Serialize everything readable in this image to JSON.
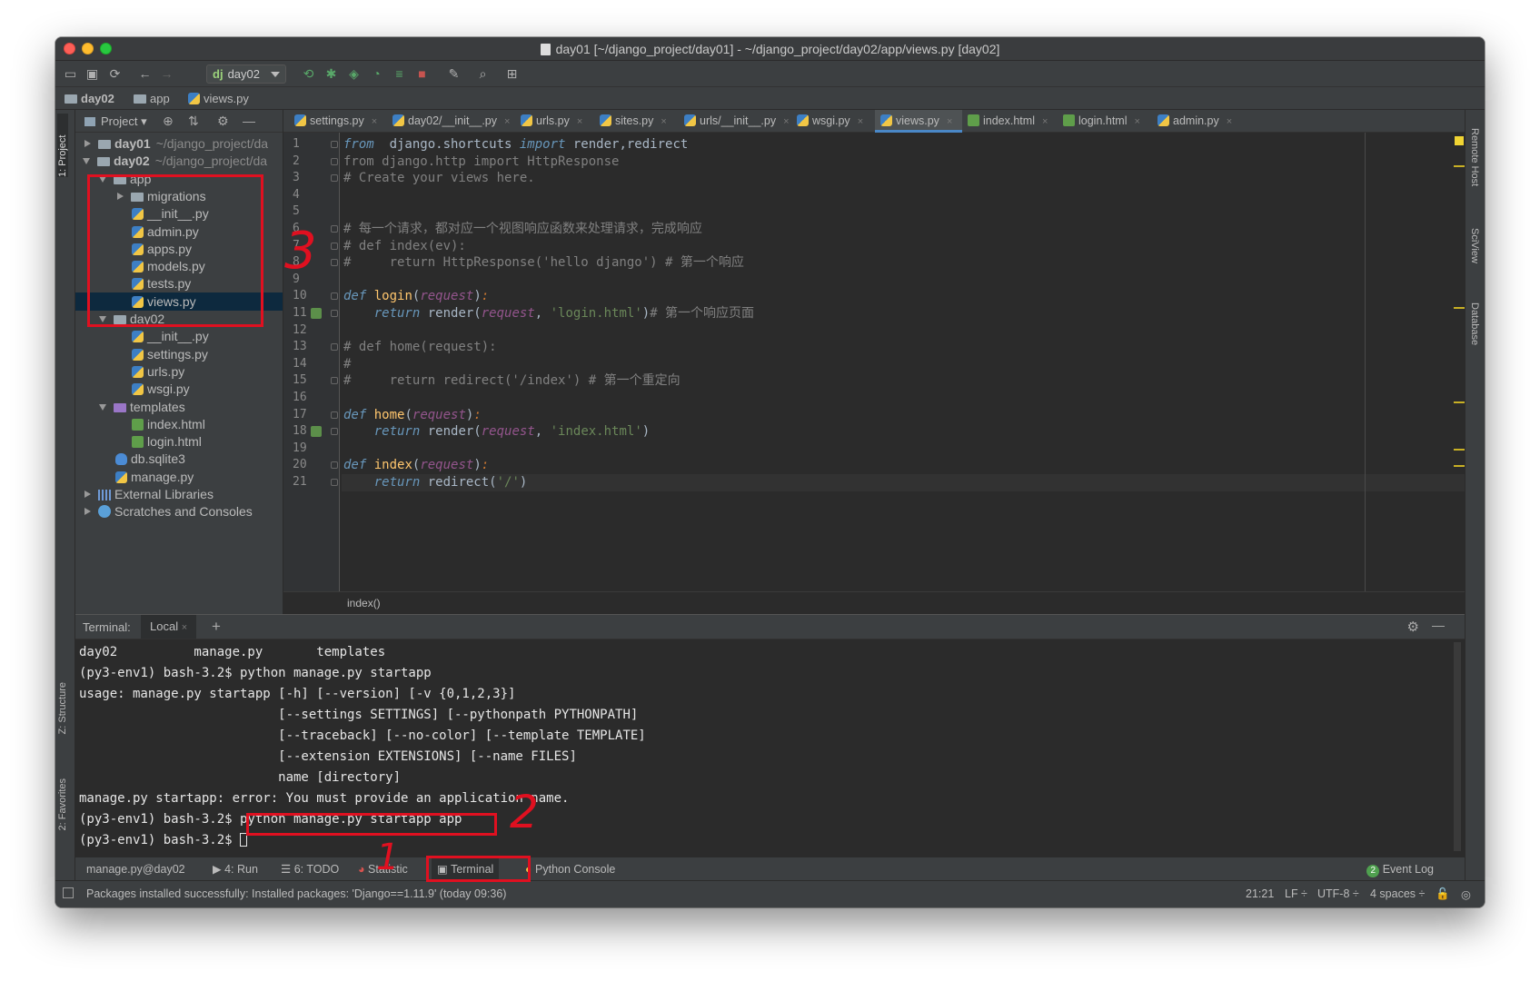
{
  "window": {
    "title": "day01 [~/django_project/day01] - ~/django_project/day02/app/views.py [day02]"
  },
  "toolbar": {
    "run_config": "day02",
    "run_config_badge": "dj"
  },
  "breadcrumb": [
    {
      "label": "day02",
      "icon": "folder-icon"
    },
    {
      "label": "app",
      "icon": "folder-icon"
    },
    {
      "label": "views.py",
      "icon": "python-file-icon"
    }
  ],
  "left_tabs": {
    "project": "1: Project",
    "structure": "Z: Structure",
    "favorites": "2: Favorites"
  },
  "right_tabs": {
    "remote_host": "Remote Host",
    "sciview": "SciView",
    "database": "Database"
  },
  "project_panel": {
    "title": "Project",
    "tree": [
      {
        "label": "day01",
        "path": "~/django_project/da",
        "type": "folder",
        "expanded": false,
        "level": 0,
        "bold": true
      },
      {
        "label": "day02",
        "path": "~/django_project/da",
        "type": "folder",
        "expanded": true,
        "level": 0,
        "bold": true
      },
      {
        "label": "app",
        "type": "folder",
        "expanded": true,
        "level": 1
      },
      {
        "label": "migrations",
        "type": "folder",
        "expanded": false,
        "level": 2
      },
      {
        "label": "__init__.py",
        "type": "py",
        "level": 3
      },
      {
        "label": "admin.py",
        "type": "py",
        "level": 3
      },
      {
        "label": "apps.py",
        "type": "py",
        "level": 3
      },
      {
        "label": "models.py",
        "type": "py",
        "level": 3
      },
      {
        "label": "tests.py",
        "type": "py",
        "level": 3
      },
      {
        "label": "views.py",
        "type": "py",
        "level": 3,
        "selected": true
      },
      {
        "label": "day02",
        "type": "folder",
        "expanded": true,
        "level": 1
      },
      {
        "label": "__init__.py",
        "type": "py",
        "level": 3
      },
      {
        "label": "settings.py",
        "type": "py",
        "level": 3
      },
      {
        "label": "urls.py",
        "type": "py",
        "level": 3
      },
      {
        "label": "wsgi.py",
        "type": "py",
        "level": 3
      },
      {
        "label": "templates",
        "type": "template",
        "expanded": true,
        "level": 1
      },
      {
        "label": "index.html",
        "type": "html",
        "level": 3
      },
      {
        "label": "login.html",
        "type": "html",
        "level": 3
      },
      {
        "label": "db.sqlite3",
        "type": "db",
        "level": 2
      },
      {
        "label": "manage.py",
        "type": "py",
        "level": 2
      },
      {
        "label": "External Libraries",
        "type": "lib",
        "expanded": false,
        "level": 0
      },
      {
        "label": "Scratches and Consoles",
        "type": "scratch",
        "expanded": false,
        "level": 0
      }
    ]
  },
  "editor_tabs": [
    {
      "label": "settings.py",
      "type": "py"
    },
    {
      "label": "day02/__init__.py",
      "type": "py"
    },
    {
      "label": "urls.py",
      "type": "py"
    },
    {
      "label": "sites.py",
      "type": "py"
    },
    {
      "label": "urls/__init__.py",
      "type": "py"
    },
    {
      "label": "wsgi.py",
      "type": "py"
    },
    {
      "label": "views.py",
      "type": "py",
      "active": true
    },
    {
      "label": "index.html",
      "type": "html"
    },
    {
      "label": "login.html",
      "type": "html"
    },
    {
      "label": "admin.py",
      "type": "py"
    }
  ],
  "code_lines": [
    [
      [
        "kwi",
        "from"
      ],
      [
        "",
        "  django.shortcuts "
      ],
      [
        "kwi",
        "import"
      ],
      [
        "",
        " render,redirect"
      ]
    ],
    [
      [
        "cm",
        "from django.http import HttpResponse"
      ]
    ],
    [
      [
        "cm",
        "# Create your views here."
      ]
    ],
    [],
    [],
    [
      [
        "cm",
        "# 每一个请求，都对应一个视图响应函数来处理请求，完成响应"
      ]
    ],
    [
      [
        "cm",
        "# def index(ev):"
      ]
    ],
    [
      [
        "cm",
        "#     return HttpResponse('hello django') # 第一个响应"
      ]
    ],
    [],
    [
      [
        "kwi",
        "def"
      ],
      [
        "",
        " "
      ],
      [
        "fn",
        "login"
      ],
      [
        "",
        "("
      ],
      [
        "param",
        "request"
      ],
      [
        "",
        ")"
      ],
      [
        "kw",
        ":"
      ]
    ],
    [
      [
        "",
        "    "
      ],
      [
        "kwi",
        "return"
      ],
      [
        "",
        " render("
      ],
      [
        "param",
        "request"
      ],
      [
        "",
        ", "
      ],
      [
        "str",
        "'login.html'"
      ],
      [
        "",
        ")"
      ],
      [
        "cm",
        "# 第一个响应页面"
      ]
    ],
    [],
    [
      [
        "cm",
        "# def home(request):"
      ]
    ],
    [
      [
        "cm",
        "#"
      ]
    ],
    [
      [
        "cm",
        "#     return redirect('/index') # 第一个重定向"
      ]
    ],
    [],
    [
      [
        "kwi",
        "def"
      ],
      [
        "",
        " "
      ],
      [
        "fn",
        "home"
      ],
      [
        "",
        "("
      ],
      [
        "param",
        "request"
      ],
      [
        "",
        ")"
      ],
      [
        "kw",
        ":"
      ]
    ],
    [
      [
        "",
        "    "
      ],
      [
        "kwi",
        "return"
      ],
      [
        "",
        " render("
      ],
      [
        "param",
        "request"
      ],
      [
        "",
        ", "
      ],
      [
        "str",
        "'index.html'"
      ],
      [
        "",
        ")"
      ]
    ],
    [],
    [
      [
        "kwi",
        "def"
      ],
      [
        "",
        " "
      ],
      [
        "fn",
        "index"
      ],
      [
        "",
        "("
      ],
      [
        "param",
        "request"
      ],
      [
        "",
        ")"
      ],
      [
        "kw",
        ":"
      ]
    ],
    [
      [
        "",
        "    "
      ],
      [
        "kwi",
        "return"
      ],
      [
        "",
        " redirect("
      ],
      [
        "str",
        "'/'"
      ],
      [
        "",
        ")"
      ]
    ]
  ],
  "editor_footer": "index()",
  "terminal": {
    "title": "Terminal:",
    "tab": "Local",
    "lines": [
      "day02          manage.py       templates",
      "(py3-env1) bash-3.2$ python manage.py startapp",
      "usage: manage.py startapp [-h] [--version] [-v {0,1,2,3}]",
      "                          [--settings SETTINGS] [--pythonpath PYTHONPATH]",
      "                          [--traceback] [--no-color] [--template TEMPLATE]",
      "                          [--extension EXTENSIONS] [--name FILES]",
      "                          name [directory]",
      "manage.py startapp: error: You must provide an application name.",
      "(py3-env1) bash-3.2$ python manage.py startapp app",
      "(py3-env1) bash-3.2$ "
    ]
  },
  "bottom_tools": [
    {
      "label": "manage.py@day02"
    },
    {
      "label": "4: Run"
    },
    {
      "label": "6: TODO"
    },
    {
      "label": "Statistic"
    },
    {
      "label": "Terminal",
      "active": true
    },
    {
      "label": "Python Console"
    }
  ],
  "event_log": {
    "badge": "2",
    "label": "Event Log"
  },
  "status_bar": {
    "message": "Packages installed successfully: Installed packages: 'Django==1.11.9' (today 09:36)",
    "position": "21:21",
    "line_sep": "LF ÷",
    "encoding": "UTF-8 ÷",
    "indent": "4 spaces ÷"
  },
  "annotations": [
    "1",
    "2",
    "3"
  ],
  "colors": {
    "annotation_red": "#e01020",
    "accent": "#4a88c7"
  }
}
